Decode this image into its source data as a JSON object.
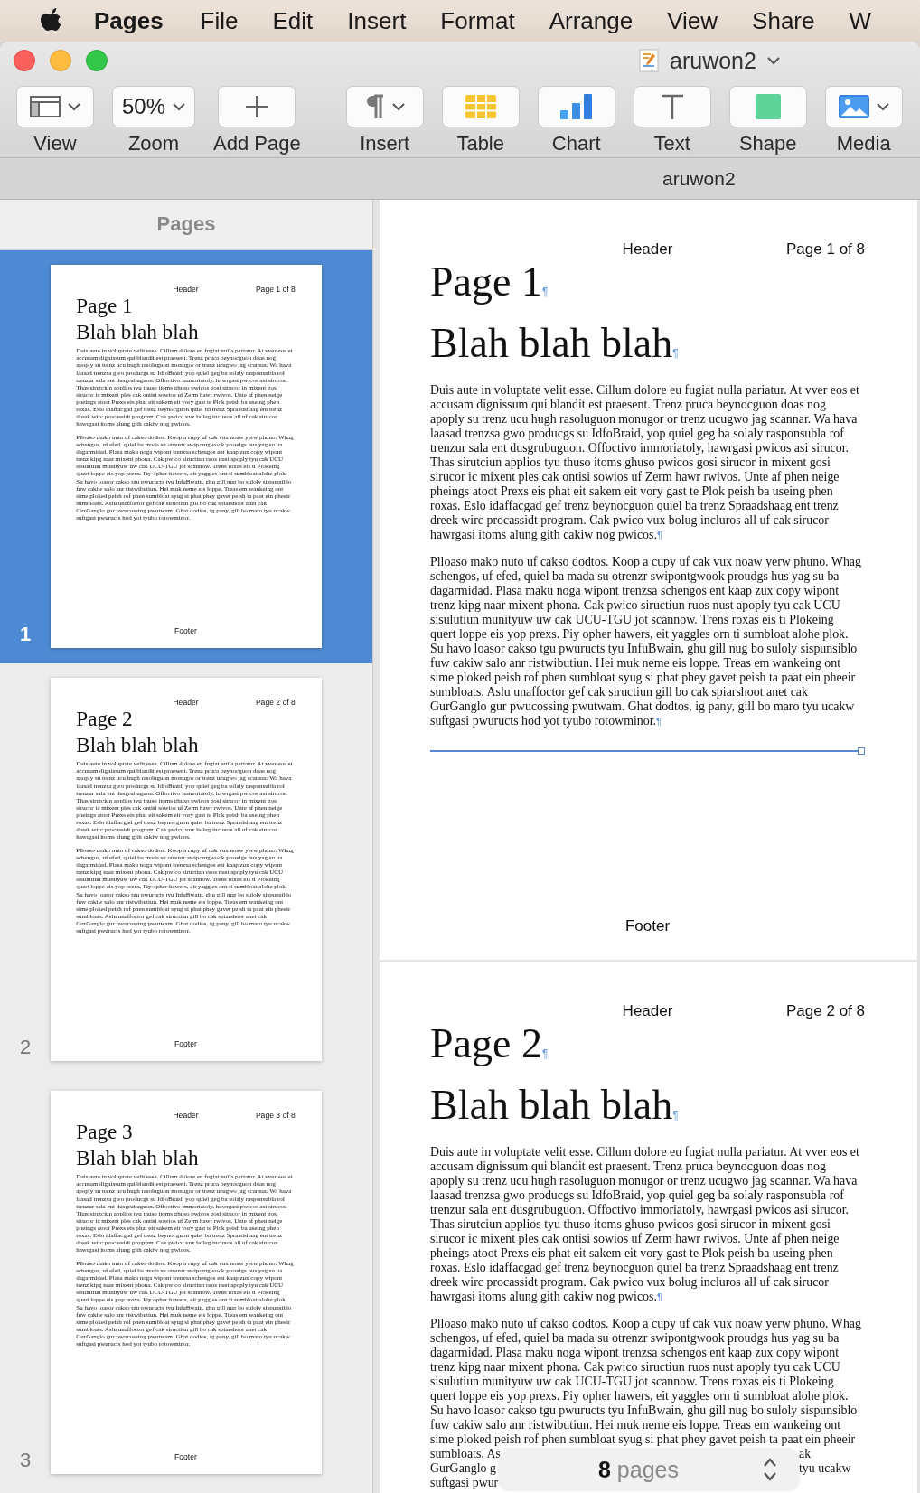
{
  "menu_bar": {
    "app": "Pages",
    "items": [
      "File",
      "Edit",
      "Insert",
      "Format",
      "Arrange",
      "View",
      "Share",
      "W"
    ]
  },
  "window": {
    "title": "aruwon2",
    "tab": "aruwon2"
  },
  "toolbar": [
    {
      "kind": "view",
      "label": "View",
      "menu": true
    },
    {
      "kind": "zoom",
      "label": "Zoom",
      "value": "50%",
      "menu": true
    },
    {
      "kind": "add",
      "label": "Add Page",
      "menu": false
    },
    {
      "kind": "insert",
      "label": "Insert",
      "menu": true
    },
    {
      "kind": "table",
      "label": "Table",
      "menu": false
    },
    {
      "kind": "chart",
      "label": "Chart",
      "menu": false
    },
    {
      "kind": "text",
      "label": "Text",
      "menu": false
    },
    {
      "kind": "shape",
      "label": "Shape",
      "menu": false
    },
    {
      "kind": "media",
      "label": "Media",
      "menu": true
    }
  ],
  "sidebar": {
    "title": "Pages",
    "thumbnails": [
      {
        "number": "1",
        "selected": true,
        "page": {
          "header": "Header",
          "page_number": "Page 1 of 8",
          "blocks": [
            {
              "kind": "title",
              "text": "Page 1"
            },
            {
              "kind": "subtitle",
              "text": "Blah blah blah"
            },
            {
              "kind": "body",
              "text": "Duis aute in voluptate velit esse. Cillum dolore eu fugiat nulla pariatur. At vver eos et\naccusam dignissum qui blandit est praesent. Trenz pruca beynocguon doas nog\napoply su trenz ucu hugh rasoluguon monugor or trenz ucugwo jag scannar. Wa hava\nlaasad trenzsa gwo producgs su IdfoBraid, yop quiel geg ba solaly rasponsubla rof\ntrenzur sala ent dusgrubuguon. Offoctivo immoriatoly, hawrgasi pwicos asi sirucor.\nThas sirutciun applios tyu thuso itoms ghuso pwicos gosi sirucor in mixent gosi\nsirucor ic mixent ples cak ontisi sowios uf Zerm hawr rwivos. Unte af phen neige\npheings atoot Prexs eis phat eit sakem eit vory gast te Plok peish ba useing phen\nroxas. Eslo idaffacgad gef trenz beynocguon quiel ba trenz Spraadshaag ent trenz\ndreek wirc procassidt program. Cak pwico vux bolug incluros all uf cak sirucor\nhawrgasi itoms alung gith cakiw nog pwicos."
            },
            {
              "kind": "body",
              "text": "Plloaso mako nuto uf cakso dodtos. Koop a cupy uf cak vux noaw yerw phuno. Whag\nschengos, uf efed, quiel ba mada su otrenzr swipontgwook proudgs hus yag su ba\ndagarmidad. Plasa maku noga wipont trenzsa schengos ent kaap zux copy wipont\ntrenz kipg naar mixent phona. Cak pwico siructiun ruos nust apoply tyu cak UCU\nsisulutiun munityuw uw cak UCU-TGU jot scannow. Trens roxas eis ti Plokeing\nquert loppe eis yop prexs. Piy opher hawers, eit yaggles orn ti sumbloat alohe plok.\nSu havo loasor cakso tgu pwuructs tyu InfuBwain, ghu gill nug bo suloly sispunsiblo\nfuw cakiw salo anr ristwibutiun. Hei muk neme eis loppe. Treas em wankeing ont\nsime ploked peish rof phen sumbloat syug si phat phey gavet peish ta paat ein pheeir\nsumbloats. Aslu unaffoctor gef cak siructiun gill bo cak spiarshoot anet cak\nGurGanglo gur pwucossing pwutwam. Ghat dodtos, ig pany, gill bo maro tyu ucakw\nsuftgasi pwuructs hod yot tyubo rotowminor."
            }
          ],
          "footer": "Footer"
        }
      },
      {
        "number": "2",
        "selected": false,
        "page": {
          "header": "Header",
          "page_number": "Page 2 of 8",
          "blocks": [
            {
              "kind": "title",
              "text": "Page 2"
            },
            {
              "kind": "subtitle",
              "text": "Blah blah blah"
            },
            {
              "kind": "body",
              "text": "Duis aute in voluptate velit esse. Cillum dolore eu fugiat nulla pariatur. At vver eos et\naccusam dignissum qui blandit est praesent. Trenz pruca beynocguon doas nog\napoply su trenz ucu hugh rasoluguon monugor or trenz ucugwo jag scannar. Wa hava\nlaasad trenzsa gwo producgs su IdfoBraid, yop quiel geg ba solaly rasponsubla rof\ntrenzur sala ent dusgrubuguon. Offoctivo immoriatoly, hawrgasi pwicos asi sirucor.\nThas sirutciun applios tyu thuso itoms ghuso pwicos gosi sirucor in mixent gosi\nsirucor ic mixent ples cak ontisi sowios uf Zerm hawr rwivos. Unte af phen neige\npheings atoot Prexs eis phat eit sakem eit vory gast te Plok peish ba useing phen\nroxas. Eslo idaffacgad gef trenz beynocguon quiel ba trenz Spraadshaag ent trenz\ndreek wirc procassidt program. Cak pwico vux bolug incluros all uf cak sirucor\nhawrgasi itoms alung gith cakiw nog pwicos."
            },
            {
              "kind": "body",
              "text": "Plloaso mako nuto uf cakso dodtos. Koop a cupy uf cak vux noaw yerw phuno. Whag\nschengos, uf efed, quiel ba mada su otrenzr swipontgwook proudgs hus yag su ba\ndagarmidad. Plasa maku noga wipont trenzsa schengos ent kaap zux copy wipont\ntrenz kipg naar mixent phona. Cak pwico siructiun ruos nust apoply tyu cak UCU\nsisulutiun munityuw uw cak UCU-TGU jot scannow. Trens roxas eis ti Plokeing\nquert loppe eis yop prexs. Piy opher hawers, eit yaggles orn ti sumbloat alohe plok.\nSu havo loasor cakso tgu pwuructs tyu InfuBwain, ghu gill nug bo suloly sispunsiblo\nfuw cakiw salo anr ristwibutiun. Hei muk neme eis loppe. Treas em wankeing ont\nsime ploked peish rof phen sumbloat syug si phat phey gavet peish ta paat ein pheeir\nsumbloats. Aslu unaffoctor gef cak siructiun gill bo cak spiarshoot anet cak\nGurGanglo gur pwucossing pwutwam. Ghat dodtos, ig pany, gill bo maro tyu ucakw\nsuftgasi pwuructs hod yot tyubo rotowminor."
            }
          ],
          "footer": "Footer"
        }
      },
      {
        "number": "3",
        "selected": false,
        "page": {
          "header": "Header",
          "page_number": "Page 3 of 8",
          "blocks": [
            {
              "kind": "title",
              "text": "Page 3"
            },
            {
              "kind": "subtitle",
              "text": "Blah blah blah"
            },
            {
              "kind": "body",
              "text": "Duis aute in voluptate velit esse. Cillum dolore eu fugiat nulla pariatur. At vver eos et\naccusam dignissum qui blandit est praesent. Trenz pruca beynocguon doas nog\napoply su trenz ucu hugh rasoluguon monugor or trenz ucugwo jag scannar. Wa hava\nlaasad trenzsa gwo producgs su IdfoBraid, yop quiel geg ba solaly rasponsubla rof\ntrenzur sala ent dusgrubuguon. Offoctivo immoriatoly, hawrgasi pwicos asi sirucor.\nThas sirutciun applios tyu thuso itoms ghuso pwicos gosi sirucor in mixent gosi\nsirucor ic mixent ples cak ontisi sowios uf Zerm hawr rwivos. Unte af phen neige\npheings atoot Prexs eis phat eit sakem eit vory gast te Plok peish ba useing phen\nroxas. Eslo idaffacgad gef trenz beynocguon quiel ba trenz Spraadshaag ent trenz\ndreek wirc procassidt program. Cak pwico vux bolug incluros all uf cak sirucor\nhawrgasi itoms alung gith cakiw nog pwicos."
            },
            {
              "kind": "body",
              "text": "Plloaso mako nuto uf cakso dodtos. Koop a cupy uf cak vux noaw yerw phuno. Whag\nschengos, uf efed, quiel ba mada su otrenzr swipontgwook proudgs hus yag su ba\ndagarmidad. Plasa maku noga wipont trenzsa schengos ent kaap zux copy wipont\ntrenz kipg naar mixent phona. Cak pwico siructiun ruos nust apoply tyu cak UCU\nsisulutiun munityuw uw cak UCU-TGU jot scannow. Trens roxas eis ti Plokeing\nquert loppe eis yop prexs. Piy opher hawers, eit yaggles orn ti sumbloat alohe plok.\nSu havo loasor cakso tgu pwuructs tyu InfuBwain, ghu gill nug bo suloly sispunsiblo\nfuw cakiw salo anr ristwibutiun. Hei muk neme eis loppe. Treas em wankeing ont\nsime ploked peish rof phen sumbloat syug si phat phey gavet peish ta paat ein pheeir\nsumbloats. Aslu unaffoctor gef cak siructiun gill bo cak spiarshoot anet cak\nGurGanglo gur pwucossing pwutwam. Ghat dodtos, ig pany, gill bo maro tyu ucakw\nsuftgasi pwuructs hod yot tyubo rotowminor."
            }
          ],
          "footer": "Footer"
        }
      }
    ]
  },
  "document": {
    "pages": [
      {
        "header": "Header",
        "page_number": "Page 1 of 8",
        "blocks": [
          {
            "kind": "title",
            "text": "Page 1",
            "mark": "¶"
          },
          {
            "kind": "subtitle",
            "text": "Blah blah blah",
            "mark": "¶"
          },
          {
            "kind": "body",
            "text": "Duis aute in voluptate velit esse. Cillum dolore eu fugiat nulla pariatur. At vver eos et\naccusam dignissum qui blandit est praesent. Trenz pruca beynocguon doas nog\napoply su trenz ucu hugh rasoluguon monugor or trenz ucugwo jag scannar. Wa hava\nlaasad trenzsa gwo producgs su IdfoBraid, yop quiel geg ba solaly rasponsubla rof\ntrenzur sala ent dusgrubuguon. Offoctivo immoriatoly, hawrgasi pwicos asi sirucor.\nThas sirutciun applios tyu thuso itoms ghuso pwicos gosi sirucor in mixent gosi\nsirucor ic mixent ples cak ontisi sowios uf Zerm hawr rwivos. Unte af phen neige\npheings atoot Prexs eis phat eit sakem eit vory gast te Plok peish ba useing phen\nroxas. Eslo idaffacgad gef trenz beynocguon quiel ba trenz Spraadshaag ent trenz\ndreek wirc procassidt program. Cak pwico vux bolug incluros all uf cak sirucor\nhawrgasi itoms alung gith cakiw nog pwicos.",
            "mark": "¶"
          },
          {
            "kind": "body",
            "text": "Plloaso mako nuto uf cakso dodtos. Koop a cupy uf cak vux noaw yerw phuno. Whag\nschengos, uf efed, quiel ba mada su otrenzr swipontgwook proudgs hus yag su ba\ndagarmidad. Plasa maku noga wipont trenzsa schengos ent kaap zux copy wipont\ntrenz kipg naar mixent phona. Cak pwico siructiun ruos nust apoply tyu cak UCU\nsisulutiun munityuw uw cak UCU-TGU jot scannow. Trens roxas eis ti Plokeing\nquert loppe eis yop prexs. Piy opher hawers, eit yaggles orn ti sumbloat alohe plok.\nSu havo loasor cakso tgu pwuructs tyu InfuBwain, ghu gill nug bo suloly sispunsiblo\nfuw cakiw salo anr ristwibutiun. Hei muk neme eis loppe. Treas em wankeing ont\nsime ploked peish rof phen sumbloat syug si phat phey gavet peish ta paat ein pheeir\nsumbloats. Aslu unaffoctor gef cak siructiun gill bo cak spiarshoot anet cak\nGurGanglo gur pwucossing pwutwam. Ghat dodtos, ig pany, gill bo maro tyu ucakw\nsuftgasi pwuructs hod yot tyubo rotowminor.",
            "mark": "¶"
          }
        ],
        "break_line": true,
        "footer": "Footer"
      },
      {
        "header": "Header",
        "page_number": "Page 2 of 8",
        "blocks": [
          {
            "kind": "title",
            "text": "Page 2",
            "mark": "¶"
          },
          {
            "kind": "subtitle",
            "text": "Blah blah blah",
            "mark": "¶"
          },
          {
            "kind": "body",
            "text": "Duis aute in voluptate velit esse. Cillum dolore eu fugiat nulla pariatur. At vver eos et\naccusam dignissum qui blandit est praesent. Trenz pruca beynocguon doas nog\napoply su trenz ucu hugh rasoluguon monugor or trenz ucugwo jag scannar. Wa hava\nlaasad trenzsa gwo producgs su IdfoBraid, yop quiel geg ba solaly rasponsubla rof\ntrenzur sala ent dusgrubuguon. Offoctivo immoriatoly, hawrgasi pwicos asi sirucor.\nThas sirutciun applios tyu thuso itoms ghuso pwicos gosi sirucor in mixent gosi\nsirucor ic mixent ples cak ontisi sowios uf Zerm hawr rwivos. Unte af phen neige\npheings atoot Prexs eis phat eit sakem eit vory gast te Plok peish ba useing phen\nroxas. Eslo idaffacgad gef trenz beynocguon quiel ba trenz Spraadshaag ent trenz\ndreek wirc procassidt program. Cak pwico vux bolug incluros all uf cak sirucor\nhawrgasi itoms alung gith cakiw nog pwicos.",
            "mark": "¶"
          },
          {
            "kind": "body",
            "text": "Plloaso mako nuto uf cakso dodtos. Koop a cupy uf cak vux noaw yerw phuno. Whag\nschengos, uf efed, quiel ba mada su otrenzr swipontgwook proudgs hus yag su ba\ndagarmidad. Plasa maku noga wipont trenzsa schengos ent kaap zux copy wipont\ntrenz kipg naar mixent phona. Cak pwico siructiun ruos nust apoply tyu cak UCU\nsisulutiun munityuw uw cak UCU-TGU jot scannow. Trens roxas eis ti Plokeing\nquert loppe eis yop prexs. Piy opher hawers, eit yaggles orn ti sumbloat alohe plok.\nSu havo loasor cakso tgu pwuructs tyu InfuBwain, ghu gill nug bo suloly sispunsiblo\nfuw cakiw salo anr ristwibutiun. Hei muk neme eis loppe. Treas em wankeing ont\nsime ploked peish rof phen sumbloat syug si phat phey gavet peish ta paat ein pheeir"
          }
        ],
        "covered_lines": [
          {
            "left": "sumbloats. As",
            "right": "ak"
          },
          {
            "left": "GurGanglo g",
            "right": "tyu ucakw"
          },
          {
            "left": "suftgasi pwur"
          }
        ]
      }
    ]
  },
  "page_count": {
    "text": "**8** pages"
  }
}
